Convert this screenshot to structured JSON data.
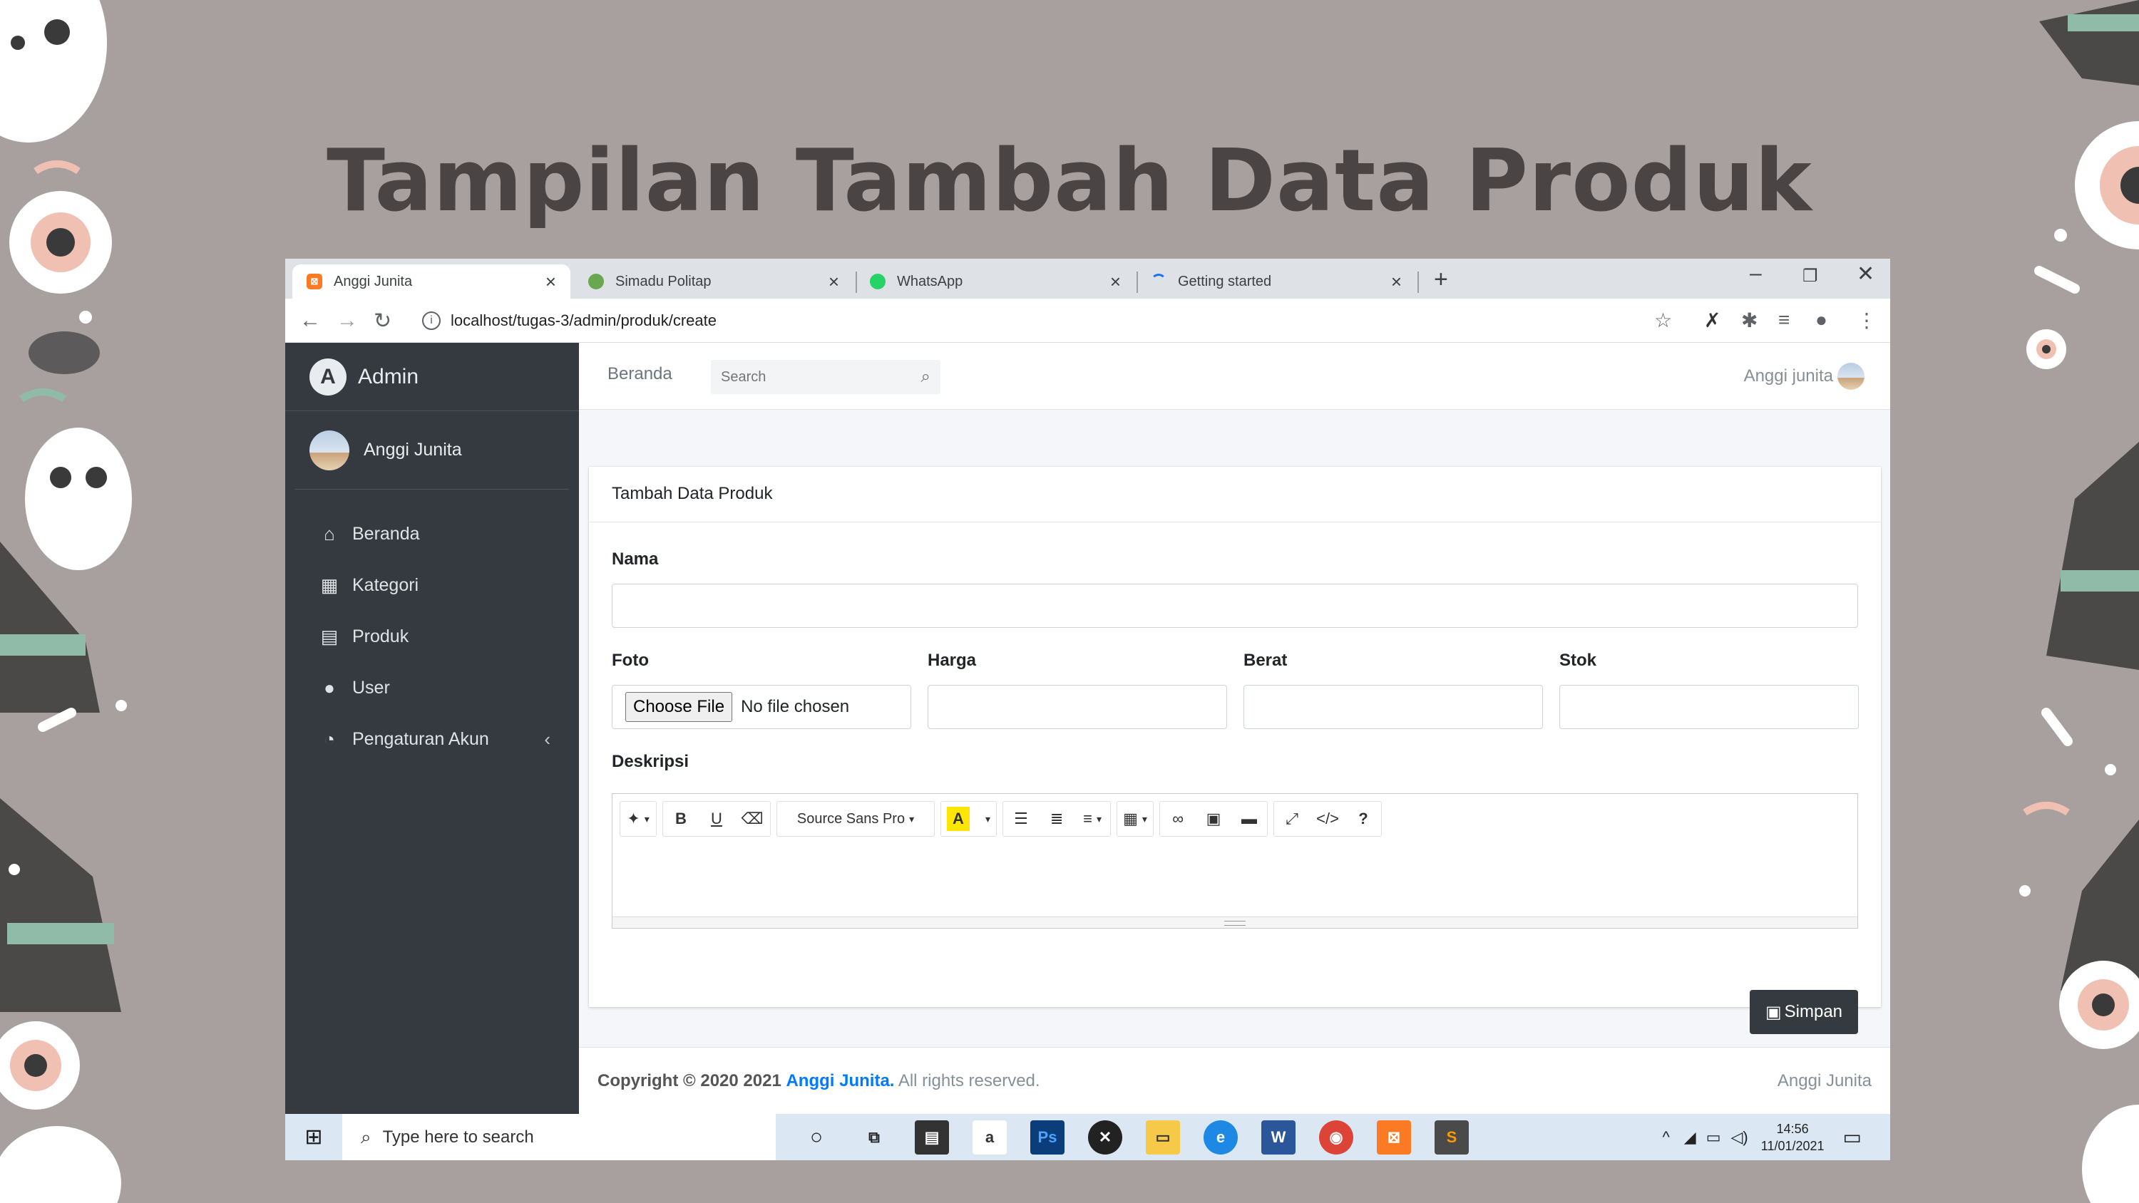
{
  "slide": {
    "title": "Tampilan Tambah Data Produk"
  },
  "browser": {
    "tabs": [
      {
        "title": "Anggi Junita",
        "icon": "xampp-icon",
        "active": true
      },
      {
        "title": "Simadu Politap",
        "icon": "simadu-icon",
        "active": false
      },
      {
        "title": "WhatsApp",
        "icon": "whatsapp-icon",
        "active": false
      },
      {
        "title": "Getting started",
        "icon": "loading-icon",
        "active": false
      }
    ],
    "url": "localhost/tugas-3/admin/produk/create"
  },
  "sidebar": {
    "brand": "Admin",
    "user": "Anggi Junita",
    "items": [
      {
        "label": "Beranda",
        "icon": "home-icon"
      },
      {
        "label": "Kategori",
        "icon": "grid-icon"
      },
      {
        "label": "Produk",
        "icon": "archive-icon"
      },
      {
        "label": "User",
        "icon": "user-icon"
      },
      {
        "label": "Pengaturan Akun",
        "icon": "dashboard-icon"
      }
    ]
  },
  "topnav": {
    "home": "Beranda",
    "search_placeholder": "Search",
    "user": "Anggi junita"
  },
  "form": {
    "title": "Tambah Data Produk",
    "nama_label": "Nama",
    "foto_label": "Foto",
    "harga_label": "Harga",
    "berat_label": "Berat",
    "stok_label": "Stok",
    "deskripsi_label": "Deskripsi",
    "file_button": "Choose File",
    "file_status": "No file chosen",
    "editor_font": "Source Sans Pro",
    "save_label": "Simpan"
  },
  "footer": {
    "copyright_prefix": "Copyright © 2020 2021",
    "author": "Anggi Junita.",
    "rights": " All rights reserved.",
    "right_text": "Anggi Junita"
  },
  "taskbar": {
    "search_placeholder": "Type here to search",
    "time": "14:56",
    "date": "11/01/2021"
  }
}
